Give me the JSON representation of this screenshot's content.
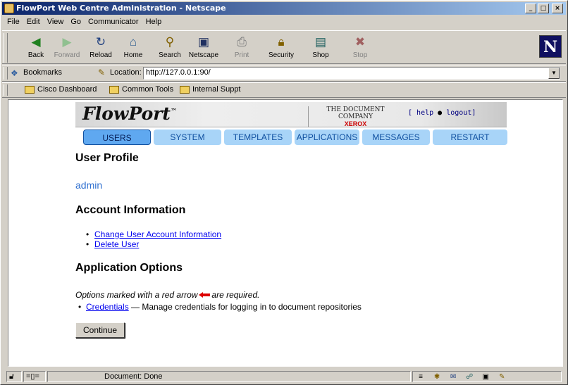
{
  "window": {
    "title": "FlowPort Web Centre Administration - Netscape"
  },
  "menu": [
    "File",
    "Edit",
    "View",
    "Go",
    "Communicator",
    "Help"
  ],
  "toolbar": {
    "buttons": [
      {
        "label": "Back",
        "icon": "back-arrow-icon",
        "enabled": true
      },
      {
        "label": "Forward",
        "icon": "forward-arrow-icon",
        "enabled": false
      },
      {
        "label": "Reload",
        "icon": "reload-icon",
        "enabled": true
      },
      {
        "label": "Home",
        "icon": "home-icon",
        "enabled": true
      },
      {
        "label": "Search",
        "icon": "search-icon",
        "enabled": true
      },
      {
        "label": "Netscape",
        "icon": "netscape-icon",
        "enabled": true
      },
      {
        "label": "Print",
        "icon": "print-icon",
        "enabled": false
      },
      {
        "label": "Security",
        "icon": "lock-icon",
        "enabled": true
      },
      {
        "label": "Shop",
        "icon": "shop-icon",
        "enabled": true
      },
      {
        "label": "Stop",
        "icon": "stop-icon",
        "enabled": false
      }
    ],
    "logo": "N"
  },
  "location": {
    "bookmarks_label": "Bookmarks",
    "location_label": "Location:",
    "url": "http://127.0.0.1:90/"
  },
  "personal_toolbar": [
    "Cisco Dashboard",
    "Common Tools",
    "Internal Suppt"
  ],
  "page": {
    "brand": "FlowPort",
    "brand_tm": "™",
    "company_line": "THE DOCUMENT COMPANY",
    "company_name": "XEROX",
    "help_link": "help",
    "logout_link": "logout",
    "nav": [
      "USERS",
      "SYSTEM",
      "TEMPLATES",
      "APPLICATIONS",
      "MESSAGES",
      "RESTART"
    ],
    "nav_active": "USERS",
    "user_profile_heading": "User Profile",
    "username": "admin",
    "account_heading": "Account Information",
    "account_links": [
      "Change User Account Information",
      "Delete User"
    ],
    "app_heading": "Application Options",
    "required_note_before": "Options marked with a red arrow",
    "required_note_after": "are required.",
    "credentials_link": "Credentials",
    "credentials_desc": "— Manage credentials for logging in to document repositories",
    "continue_label": "Continue"
  },
  "status": {
    "text": "Document: Done"
  },
  "colors": {
    "accent_nav": "#a8d4f8",
    "nav_active": "#5fa8f0",
    "link": "#0000ee",
    "required_arrow": "#dd0000"
  }
}
